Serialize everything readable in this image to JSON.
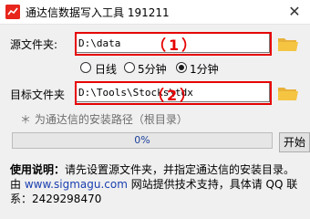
{
  "window": {
    "title": "通达信数据写入工具 191211",
    "close_glyph": "✕"
  },
  "source": {
    "label": "源文件夹:",
    "value": "D:\\data",
    "annotation": "（1）"
  },
  "interval": {
    "options": [
      {
        "label": "日线",
        "checked": false
      },
      {
        "label": "5分钟",
        "checked": false
      },
      {
        "label": "1分钟",
        "checked": true
      }
    ]
  },
  "target": {
    "label": "目标文件夹",
    "value": "D:\\Tools\\Stocks\\tdx",
    "annotation": "（2）",
    "hint": "＊ 为通达信的安装路径（根目录）"
  },
  "progress": {
    "value": 0,
    "text": "0%"
  },
  "start_button": "开始",
  "usage": {
    "heading": "使用说明：",
    "text1": "请先设置源文件夹，并指定通达信的安装目录。由 ",
    "link": "www.sigmagu.com",
    "text2": " 网站提供技术支持，具体请 QQ 联系：2429298470"
  },
  "colors": {
    "annotation": "#e60000",
    "link": "#1a3fb0",
    "folder": "#f5c542"
  },
  "icons": [
    "app-icon",
    "close-icon",
    "folder-icon"
  ]
}
